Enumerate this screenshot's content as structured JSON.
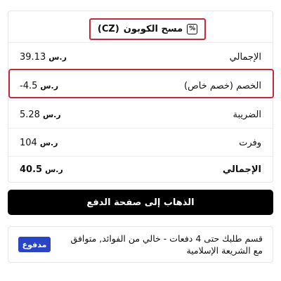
{
  "coupon": {
    "label": "مسح الكوبون",
    "code": "(CZ)",
    "icon": "percent-icon"
  },
  "summary": {
    "currency_symbol": "ر.س",
    "rows": [
      {
        "label": "الإجمالي",
        "value": "39.13"
      },
      {
        "label": "الخصم (خصم خاص)",
        "value": "-4.5"
      },
      {
        "label": "الضريبة",
        "value": "5.28"
      },
      {
        "label": "وفرت",
        "value": "104"
      },
      {
        "label": "الإجمالي",
        "value": "40.5"
      }
    ]
  },
  "checkout": {
    "label": "الذهاب إلى صفحة الدفع"
  },
  "installments": {
    "logo_text": "مدفوع",
    "text": "قسم طلبك حتى 4 دفعات - خالي من الفوائد, متوافق مع الشريعة الإسلامية"
  },
  "colors": {
    "highlight": "#c8263a",
    "button_bg": "#000000",
    "logo_bg": "#2a44c8"
  }
}
